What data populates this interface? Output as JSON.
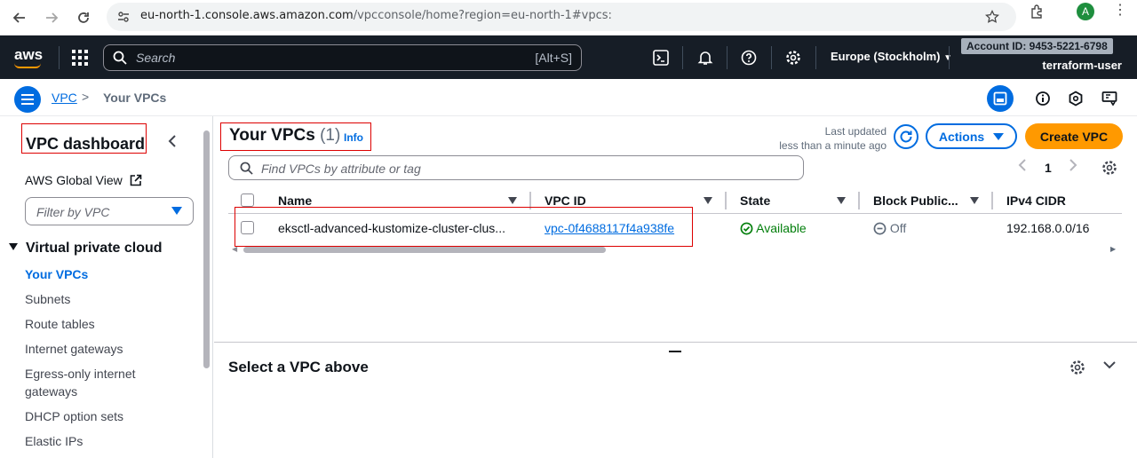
{
  "browser": {
    "url_host": "eu-north-1.console.aws.amazon.com",
    "url_path": "/vpcconsole/home?region=eu-north-1#vpcs:",
    "profile_initial": "A"
  },
  "header": {
    "logo": "aws",
    "search_placeholder": "Search",
    "search_shortcut": "[Alt+S]",
    "region": "Europe (Stockholm)",
    "account_id": "Account ID: 9453-5221-6798",
    "user": "terraform-user"
  },
  "breadcrumb": {
    "root": "VPC",
    "separator": ">",
    "current": "Your VPCs"
  },
  "sidebar": {
    "title": "VPC dashboard",
    "global_view": "AWS Global View",
    "filter_placeholder": "Filter by VPC",
    "section": "Virtual private cloud",
    "items": [
      {
        "label": "Your VPCs",
        "active": true
      },
      {
        "label": "Subnets"
      },
      {
        "label": "Route tables"
      },
      {
        "label": "Internet gateways"
      },
      {
        "label": "Egress-only internet gateways"
      },
      {
        "label": "DHCP option sets"
      },
      {
        "label": "Elastic IPs"
      }
    ]
  },
  "main": {
    "title": "Your VPCs",
    "count": "(1)",
    "info": "Info",
    "last_updated_label": "Last updated",
    "last_updated_value": "less than a minute ago",
    "actions_label": "Actions",
    "create_label": "Create VPC",
    "find_placeholder": "Find VPCs by attribute or tag",
    "page_number": "1",
    "columns": [
      "Name",
      "VPC ID",
      "State",
      "Block Public...",
      "IPv4 CIDR"
    ],
    "rows": [
      {
        "name": "eksctl-advanced-kustomize-cluster-clus...",
        "vpc_id": "vpc-0f4688117f4a938fe",
        "state": "Available",
        "block_public": "Off",
        "ipv4_cidr": "192.168.0.0/16"
      }
    ]
  },
  "detail": {
    "title": "Select a VPC above"
  },
  "colors": {
    "aws_header": "#161d26",
    "link_blue": "#006ce0",
    "primary_orange": "#ff9900",
    "success_green": "#037f0c",
    "annotation_red": "#dd0000"
  }
}
